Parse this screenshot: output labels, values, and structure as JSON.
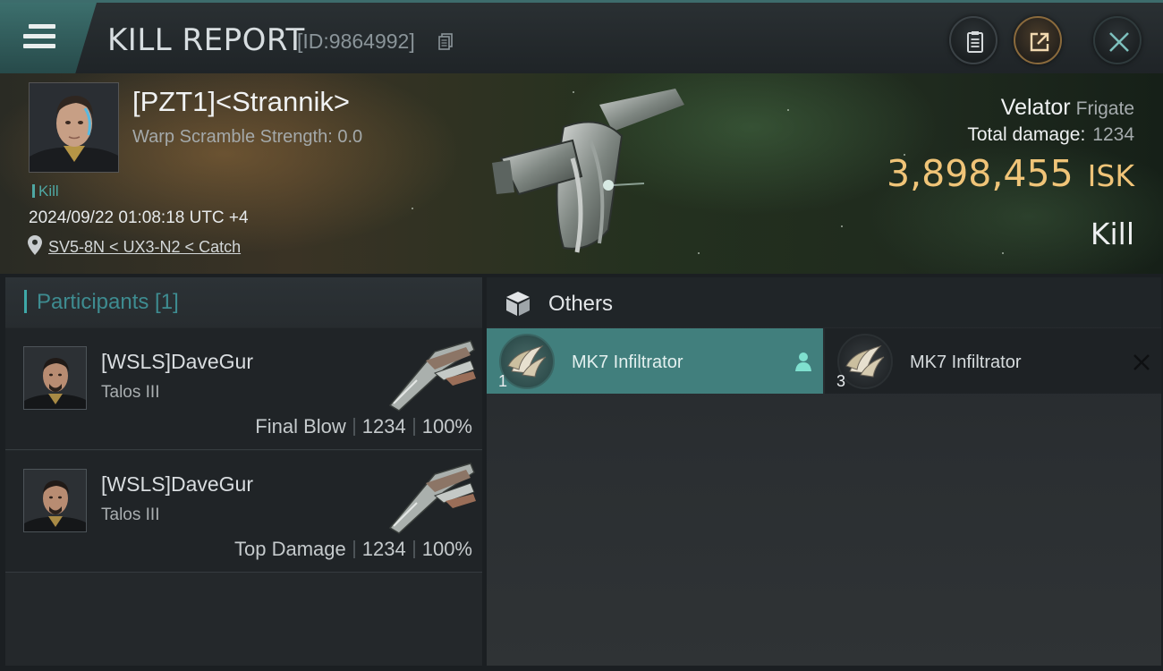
{
  "header": {
    "title": "KILL REPORT",
    "report_id": "[ID:9864992]"
  },
  "victim": {
    "name": "[PZT1]<Strannik>",
    "warp_scramble": "Warp Scramble Strength: 0.0",
    "tag": "Kill",
    "datetime": "2024/09/22 01:08:18 UTC +4",
    "location": "SV5-8N < UX3-N2 < Catch",
    "ship_name": "Velator",
    "ship_class": "Frigate",
    "total_damage_label": "Total damage:",
    "total_damage_value": "1234",
    "isk_value": "3,898,455",
    "isk_unit": "ISK",
    "result": "Kill"
  },
  "participants": {
    "heading": "Participants [1]",
    "rows": [
      {
        "name": "[WSLS]DaveGur",
        "ship": "Talos III",
        "role": "Final Blow",
        "damage": "1234",
        "percent": "100%"
      },
      {
        "name": "[WSLS]DaveGur",
        "ship": "Talos III",
        "role": "Top Damage",
        "damage": "1234",
        "percent": "100%"
      }
    ]
  },
  "others": {
    "heading": "Others",
    "items": [
      {
        "qty": "1",
        "name": "MK7 Infiltrator",
        "status": "fitted"
      },
      {
        "qty": "3",
        "name": "MK7 Infiltrator",
        "status": "destroyed"
      }
    ]
  },
  "colors": {
    "accent_teal": "#417f7d",
    "isk_gold": "#f0c478"
  }
}
